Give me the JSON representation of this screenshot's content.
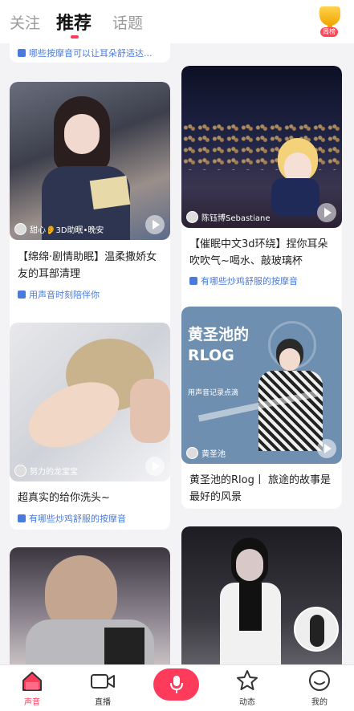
{
  "top_tabs": [
    "关注",
    "推荐",
    "话题"
  ],
  "trophy_badge": "周榜",
  "feed": {
    "partial_topic": "哪些按摩音可以让耳朵舒适达...",
    "cards": [
      {
        "author": "甜心👂3D助眠•晚安",
        "title": "【绵绵·剧情助眠】温柔撒娇女友的耳部清理",
        "topic": "用声音时刻陪伴你"
      },
      {
        "author": "陈钰博Sebastiane",
        "title": "【催眠中文3d环绕】捏你耳朵吹吹气~喝水、敲玻璃杯",
        "topic": "有哪些炒鸡舒服的按摩音"
      },
      {
        "author": "努力的龙宝宝",
        "title": "超真实的给你洗头~",
        "topic": "有哪些炒鸡舒服的按摩音"
      },
      {
        "author": "黄圣池",
        "title": "黄圣池的Rlog丨 旅途的故事是最好的风景",
        "topic": "",
        "poster_title": "黄圣池的RLOG",
        "poster_subtitle": "用声音记录点滴"
      }
    ]
  },
  "bottom_nav": [
    {
      "label": "声音",
      "icon": "house-icon"
    },
    {
      "label": "直播",
      "icon": "camera-icon"
    },
    {
      "label": "",
      "icon": "microphone-icon"
    },
    {
      "label": "动态",
      "icon": "star-icon"
    },
    {
      "label": "我的",
      "icon": "profile-icon"
    }
  ],
  "colors": {
    "accent": "#ff3b5c",
    "topic": "#4a7bdc"
  }
}
